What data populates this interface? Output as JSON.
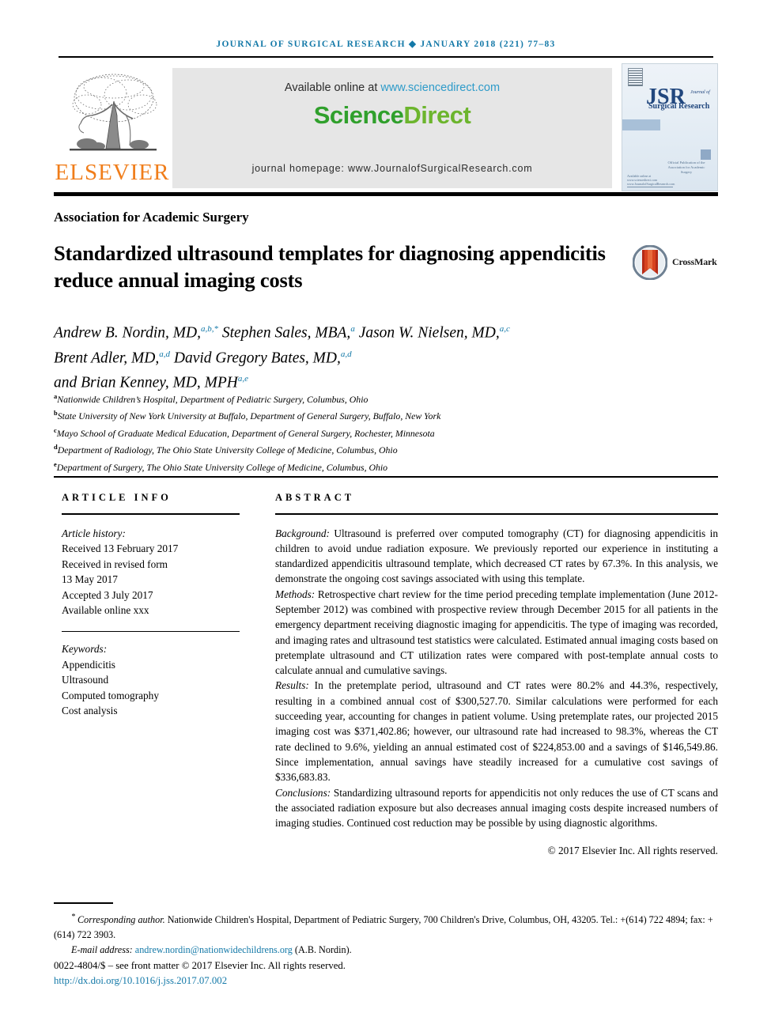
{
  "running_head": "JOURNAL OF SURGICAL RESEARCH ◆ JANUARY 2018 (221) 77–83",
  "masthead": {
    "publisher_name": "ELSEVIER",
    "publisher_logo_alt": "tree-illustration",
    "available_prefix": "Available online at ",
    "available_link": "www.sciencedirect.com",
    "platform_logo_main": "Science",
    "platform_logo_tail": "Direct",
    "journal_homepage": "journal homepage: www.JournalofSurgicalResearch.com",
    "cover": {
      "acronym": "JSR",
      "sub_small": "Journal of",
      "sub_large": "Surgical Research",
      "association_line": "Official Publication of the Association for Academic Surgery",
      "footer_line": "Available online at www.sciencedirect.com www.JournalofSurgicalResearch.com"
    }
  },
  "society": "Association for Academic Surgery",
  "title": "Standardized ultrasound templates for diagnosing appendicitis reduce annual imaging costs",
  "crossmark": {
    "label": "CrossMark"
  },
  "authors_line1_a": "Andrew B. Nordin, MD,",
  "authors_line1_a_sup": "a,b,*",
  "authors_line1_b": " Stephen Sales, MBA,",
  "authors_line1_b_sup": "a",
  "authors_line1_c": " Jason W. Nielsen, MD,",
  "authors_line1_c_sup": "a,c",
  "authors_line2_a": "Brent Adler, MD,",
  "authors_line2_a_sup": "a,d",
  "authors_line2_b": " David Gregory Bates, MD,",
  "authors_line2_b_sup": "a,d",
  "authors_line3_a": "and Brian Kenney, MD, MPH",
  "authors_line3_a_sup": "a,e",
  "affiliations": [
    {
      "mark": "a",
      "text": "Nationwide Children’s Hospital, Department of Pediatric Surgery, Columbus, Ohio"
    },
    {
      "mark": "b",
      "text": "State University of New York University at Buffalo, Department of General Surgery, Buffalo, New York"
    },
    {
      "mark": "c",
      "text": "Mayo School of Graduate Medical Education, Department of General Surgery, Rochester, Minnesota"
    },
    {
      "mark": "d",
      "text": "Department of Radiology, The Ohio State University College of Medicine, Columbus, Ohio"
    },
    {
      "mark": "e",
      "text": "Department of Surgery, The Ohio State University College of Medicine, Columbus, Ohio"
    }
  ],
  "article_info": {
    "heading": "ARTICLE INFO",
    "history_label": "Article history:",
    "history_lines": [
      "Received 13 February 2017",
      "Received in revised form",
      "13 May 2017",
      "Accepted 3 July 2017",
      "Available online xxx"
    ],
    "keywords_label": "Keywords:",
    "keywords": [
      "Appendicitis",
      "Ultrasound",
      "Computed tomography",
      "Cost analysis"
    ]
  },
  "abstract": {
    "heading": "ABSTRACT",
    "sections": [
      {
        "label": "Background:",
        "text": " Ultrasound is preferred over computed tomography (CT) for diagnosing appendicitis in children to avoid undue radiation exposure. We previously reported our experience in instituting a standardized appendicitis ultrasound template, which decreased CT rates by 67.3%. In this analysis, we demonstrate the ongoing cost savings associated with using this template."
      },
      {
        "label": "Methods:",
        "text": " Retrospective chart review for the time period preceding template implementation (June 2012-September 2012) was combined with prospective review through December 2015 for all patients in the emergency department receiving diagnostic imaging for appendicitis. The type of imaging was recorded, and imaging rates and ultrasound test statistics were calculated. Estimated annual imaging costs based on pretemplate ultrasound and CT utilization rates were compared with post-template annual costs to calculate annual and cumulative savings."
      },
      {
        "label": "Results:",
        "text": " In the pretemplate period, ultrasound and CT rates were 80.2% and 44.3%, respectively, resulting in a combined annual cost of $300,527.70. Similar calculations were performed for each succeeding year, accounting for changes in patient volume. Using pretemplate rates, our projected 2015 imaging cost was $371,402.86; however, our ultrasound rate had increased to 98.3%, whereas the CT rate declined to 9.6%, yielding an annual estimated cost of $224,853.00 and a savings of $146,549.86. Since implementation, annual savings have steadily increased for a cumulative cost savings of $336,683.83."
      },
      {
        "label": "Conclusions:",
        "text": " Standardizing ultrasound reports for appendicitis not only reduces the use of CT scans and the associated radiation exposure but also decreases annual imaging costs despite increased numbers of imaging studies. Continued cost reduction may be possible by using diagnostic algorithms."
      }
    ],
    "copyright": "© 2017 Elsevier Inc. All rights reserved."
  },
  "footnotes": {
    "corresponding_label": "Corresponding author.",
    "corresponding_text": " Nationwide Children's Hospital, Department of Pediatric Surgery, 700 Children's Drive, Columbus, OH, 43205. Tel.: +(614) 722 4894; fax: +(614) 722 3903.",
    "email_label": "E-mail address:",
    "email_link": "andrew.nordin@nationwidechildrens.org",
    "email_suffix": " (A.B. Nordin).",
    "front_matter": "0022-4804/$ – see front matter © 2017 Elsevier Inc. All rights reserved.",
    "doi": "http://dx.doi.org/10.1016/j.jss.2017.07.002"
  },
  "colors": {
    "link_blue": "#1479a8",
    "sciencedirect_green": "#30a02c",
    "elsevier_orange": "#f07d1a",
    "cover_blue": "#21477e"
  }
}
